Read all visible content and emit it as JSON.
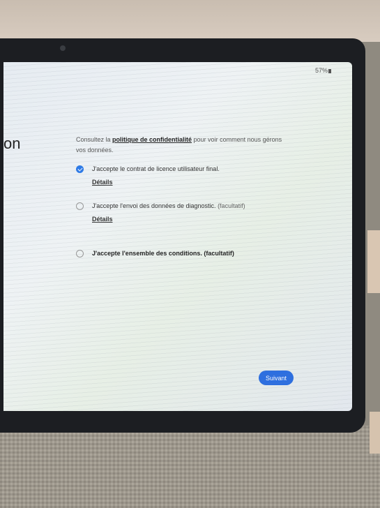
{
  "status_bar": {
    "battery": "57%"
  },
  "page": {
    "heading_fragment": "on"
  },
  "privacy": {
    "prefix": "Consultez la ",
    "link": "politique de confidentialité",
    "suffix": " pour voir comment nous gérons vos données."
  },
  "options": [
    {
      "label": "J'accepte le contrat de licence utilisateur final.",
      "checked": true,
      "details": "Détails"
    },
    {
      "label": "J'accepte l'envoi des données de diagnostic.",
      "optional": " (facultatif)",
      "checked": false,
      "details": "Détails"
    },
    {
      "label": "J'accepte l'ensemble des conditions.",
      "optional": " (facultatif)",
      "checked": false
    }
  ],
  "buttons": {
    "next": "Suivant"
  },
  "colors": {
    "accent": "#2d6fe0",
    "checkbox": "#2d7ae8"
  }
}
